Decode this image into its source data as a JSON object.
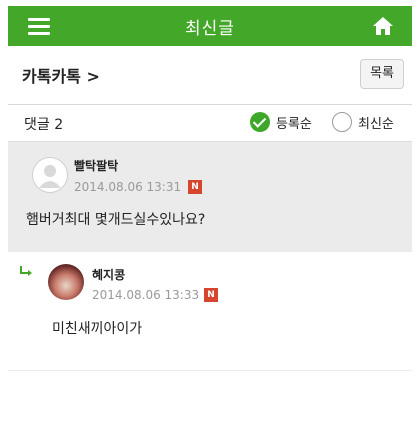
{
  "header": {
    "title": "최신글",
    "menu_icon": "hamburger-menu-icon",
    "home_icon": "home-icon",
    "bar_color": "#43a829"
  },
  "board": {
    "name": "카톡카톡 >",
    "list_button_label": "목록"
  },
  "comments_header": {
    "count_label": "댓글 2",
    "sort_options": [
      {
        "label": "등록순",
        "selected": true
      },
      {
        "label": "최신순",
        "selected": false
      }
    ]
  },
  "comments": [
    {
      "author": "빨탁팔탁",
      "date": "2014.08.06 13:31",
      "badge": "N",
      "text": "햄버거최대 몇개드실수있나요?",
      "avatar_icon": "default-user-avatar-icon"
    },
    {
      "author": "혜지콩",
      "date": "2014.08.06 13:33",
      "badge": "N",
      "text": "미친새끼아이가",
      "avatar_icon": "user-photo-avatar",
      "is_reply": true,
      "reply_icon": "reply-arrow-icon"
    }
  ]
}
